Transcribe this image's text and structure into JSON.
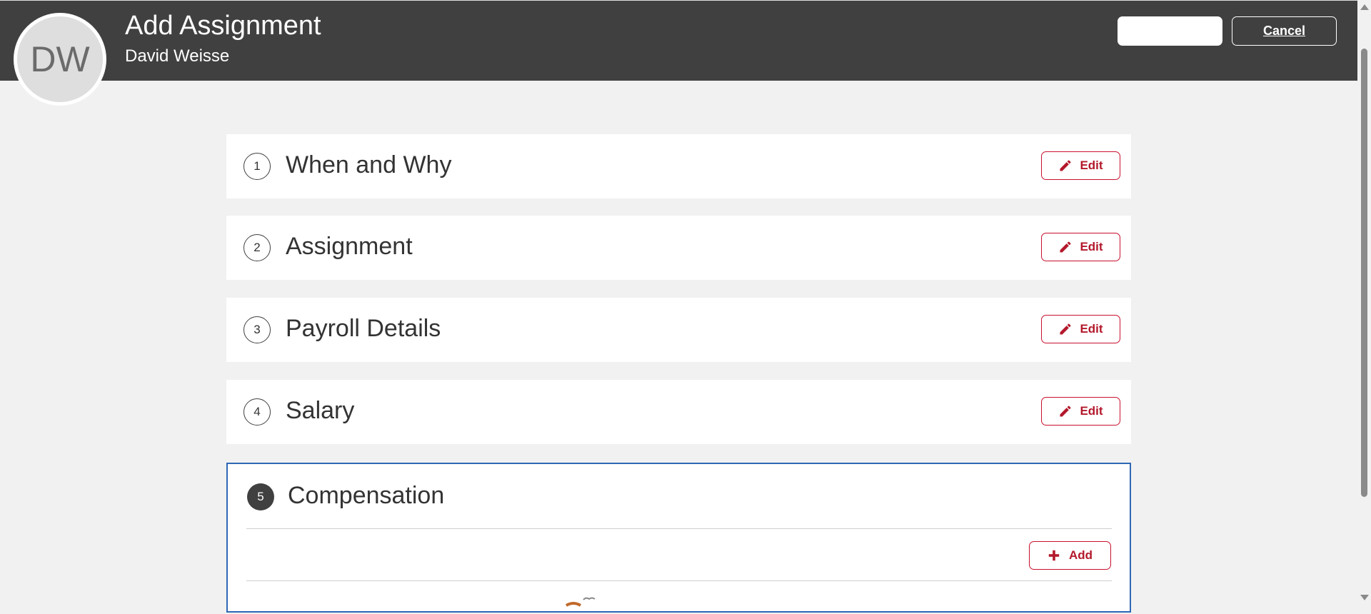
{
  "header": {
    "title": "Add Assignment",
    "person_name": "David Weisse",
    "avatar_initials": "DW",
    "submit_label": "",
    "cancel_label": "Cancel"
  },
  "sections": [
    {
      "number": "1",
      "title": "When and Why",
      "edit_label": "Edit"
    },
    {
      "number": "2",
      "title": "Assignment",
      "edit_label": "Edit"
    },
    {
      "number": "3",
      "title": "Payroll Details",
      "edit_label": "Edit"
    },
    {
      "number": "4",
      "title": "Salary",
      "edit_label": "Edit"
    }
  ],
  "active_section": {
    "number": "5",
    "title": "Compensation",
    "add_label": "Add"
  },
  "icons": {
    "edit": "pencil-icon",
    "add": "plus-icon"
  },
  "colors": {
    "header_bg": "#404040",
    "accent_red": "#b3182b",
    "active_border": "#2e68b5",
    "page_bg": "#f1f1f1"
  }
}
